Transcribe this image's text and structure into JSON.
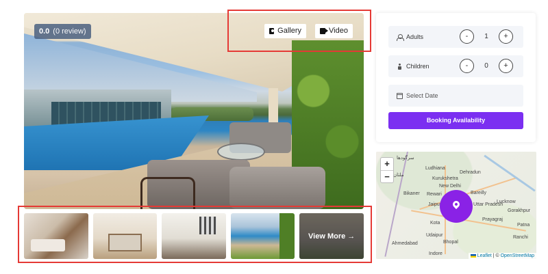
{
  "hero": {
    "rating_score": "0.0",
    "rating_reviews": "(0 review)",
    "gallery_label": "Gallery",
    "video_label": "Video"
  },
  "thumbnails": {
    "view_more_label": "View More →"
  },
  "booking": {
    "adults_label": "Adults",
    "adults_value": "1",
    "children_label": "Children",
    "children_value": "0",
    "minus": "-",
    "plus": "+",
    "date_placeholder": "Select Date",
    "submit_label": "Booking Availability",
    "accent_color": "#7b2ff1"
  },
  "map": {
    "zoom_in": "+",
    "zoom_out": "−",
    "cities": {
      "c1": "سرگودھا",
      "c2": "Ludhiana",
      "c3": "Dehradun",
      "c4": "ملتان",
      "c5": "Kurukshetra",
      "c6": "New Delhi",
      "c7": "Bareilly",
      "c8": "Bikaner",
      "c9": "Rewari",
      "c10": "Uttar Pradesh",
      "c11": "Jaipur",
      "c12": "Lucknow",
      "c13": "Gorakhpur",
      "c14": "Prayagraj",
      "c15": "Kota",
      "c16": "Patna",
      "c17": "Udaipur",
      "c18": "Ranchi",
      "c19": "Ahmedabad",
      "c20": "Bhopal",
      "c21": "Indore"
    },
    "attribution_leaflet": "Leaflet",
    "attribution_sep": " | © ",
    "attribution_osm": "OpenStreetMap",
    "marker_color": "#8a22e6"
  }
}
